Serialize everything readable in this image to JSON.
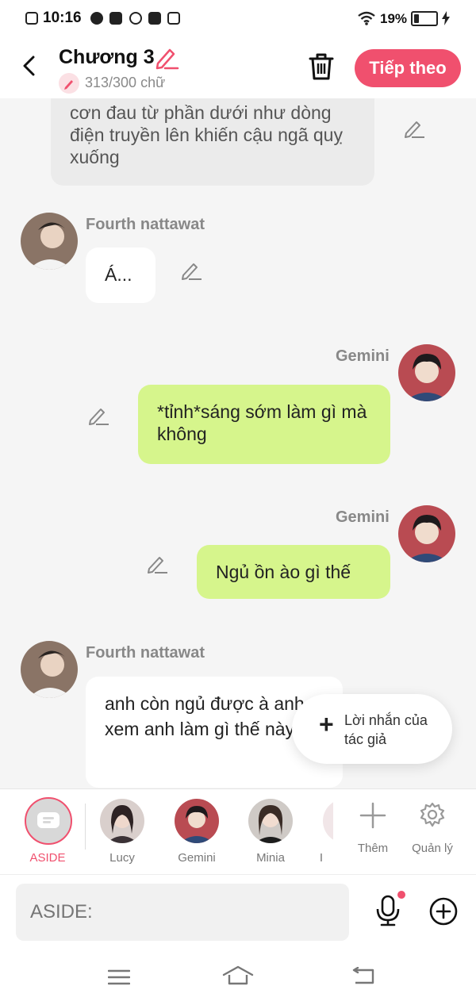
{
  "status_bar": {
    "time": "10:16",
    "battery": "19%"
  },
  "header": {
    "title": "Chương 3",
    "count": "313/300 chữ",
    "next_label": "Tiếp theo"
  },
  "messages": [
    {
      "text": "cơn đau từ phần dưới như dòng điện truyền lên khiến cậu ngã quỵ xuống"
    },
    {
      "sender": "Fourth nattawat",
      "text": "Á..."
    },
    {
      "sender": "Gemini",
      "text": "*tỉnh*sáng sớm làm gì mà không"
    },
    {
      "sender": "Gemini",
      "text": "Ngủ ồn ào gì thế"
    },
    {
      "sender": "Fourth nattawat",
      "text": "anh còn ngủ được à anh xem anh làm gì thế này"
    }
  ],
  "author_note": {
    "label": "Lời nhắn của tác giả"
  },
  "characters": [
    {
      "label": "ASIDE",
      "active": true
    },
    {
      "label": "Lucy"
    },
    {
      "label": "Gemini"
    },
    {
      "label": "Minia"
    },
    {
      "label": "I"
    }
  ],
  "actions": {
    "add_label": "Thêm",
    "manage_label": "Quản lý"
  },
  "input": {
    "placeholder": "ASIDE:"
  },
  "colors": {
    "accent": "#f0506e",
    "bubble_green": "#d6f58c",
    "bubble_white": "#ffffff",
    "bubble_gray": "#ebebeb"
  }
}
